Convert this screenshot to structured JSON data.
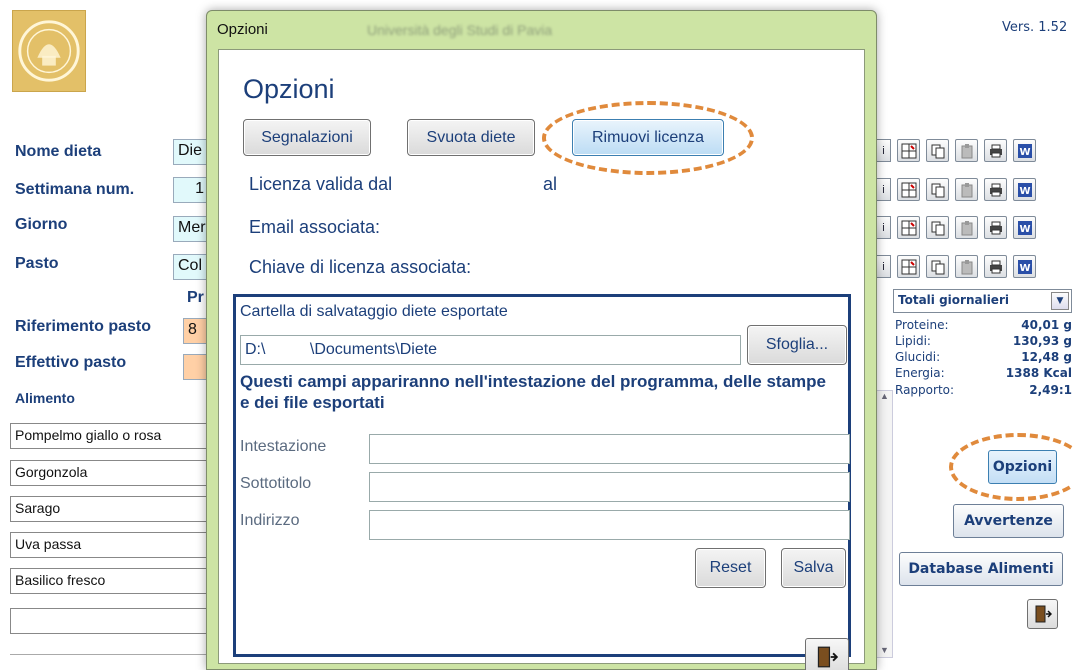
{
  "version": "Vers. 1.52",
  "main": {
    "labels": {
      "nome_dieta": "Nome dieta",
      "settimana": "Settimana num.",
      "giorno": "Giorno",
      "pasto": "Pasto",
      "pr": "Pr",
      "riferimento": "Riferimento pasto",
      "effettivo": "Effettivo pasto",
      "alimento": "Alimento"
    },
    "values": {
      "nome_dieta": "Die",
      "settimana": "1",
      "giorno": "Mer",
      "pasto": "Col",
      "riferimento": "8"
    },
    "foods": [
      "Pompelmo giallo o rosa",
      "Gorgonzola",
      "Sarago",
      "Uva passa",
      "Basilico fresco",
      ""
    ],
    "row_frag": "i"
  },
  "totals": {
    "selector": "Totali giornalieri",
    "rows": [
      {
        "label": "Proteine:",
        "value": "40,01 g"
      },
      {
        "label": "Lipidi:",
        "value": "130,93 g"
      },
      {
        "label": "Glucidi:",
        "value": "12,48 g"
      },
      {
        "label": "Energia:",
        "value": "1388 Kcal"
      },
      {
        "label": "Rapporto:",
        "value": "2,49:1"
      }
    ]
  },
  "right_buttons": {
    "opzioni": "Opzioni",
    "avvertenze": "Avvertenze",
    "database": "Database Alimenti"
  },
  "dialog": {
    "window_title": "Opzioni",
    "blurred_text": "Università degli Studi di Pavia",
    "heading": "Opzioni",
    "buttons": {
      "segnalazioni": "Segnalazioni",
      "svuota": "Svuota diete",
      "rimuovi": "Rimuovi licenza"
    },
    "license": {
      "valid_from": "Licenza valida dal",
      "to": "al",
      "email": "Email associata:",
      "key": "Chiave di licenza associata:"
    },
    "folder": {
      "title": "Cartella di salvataggio diete esportate",
      "path_drive": "D:\\",
      "path_rest": "\\Documents\\Diete",
      "browse": "Sfoglia..."
    },
    "notice": "Questi campi appariranno nell'intestazione del programma, delle stampe e dei file esportati",
    "fields": {
      "intestazione": {
        "label": "Intestazione",
        "value": ""
      },
      "sottotitolo": {
        "label": "Sottotitolo",
        "value": ""
      },
      "indirizzo": {
        "label": "Indirizzo",
        "value": ""
      }
    },
    "reset": "Reset",
    "salva": "Salva"
  },
  "colors": {
    "accent": "#1c3f7a",
    "highlight": "#e08a3c",
    "dialog_frame": "#cde4a4",
    "field_cyan": "#e1f9fb",
    "field_orange": "#ffd0a6"
  }
}
